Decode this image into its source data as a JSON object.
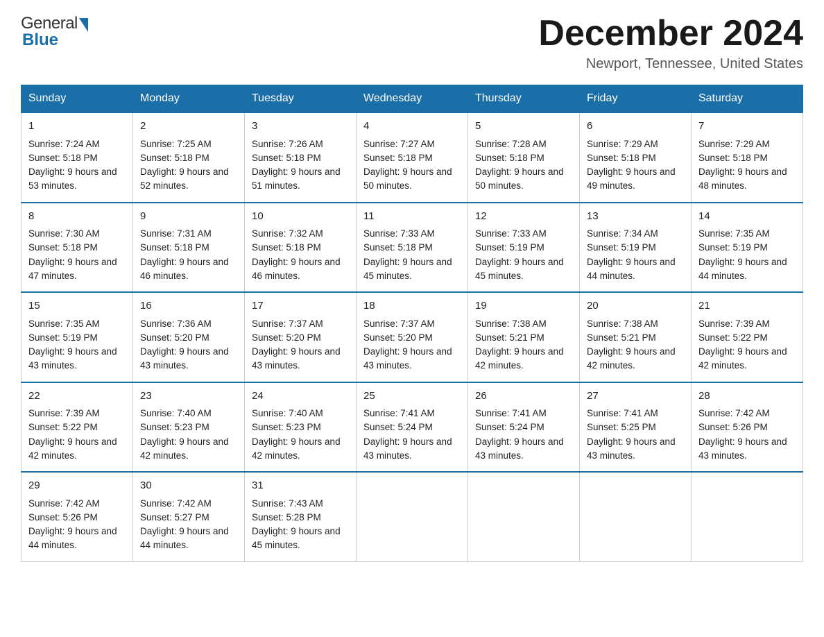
{
  "header": {
    "title": "December 2024",
    "subtitle": "Newport, Tennessee, United States",
    "logo_general": "General",
    "logo_blue": "Blue"
  },
  "days_of_week": [
    "Sunday",
    "Monday",
    "Tuesday",
    "Wednesday",
    "Thursday",
    "Friday",
    "Saturday"
  ],
  "weeks": [
    [
      {
        "day": "1",
        "sunrise": "7:24 AM",
        "sunset": "5:18 PM",
        "daylight": "9 hours and 53 minutes."
      },
      {
        "day": "2",
        "sunrise": "7:25 AM",
        "sunset": "5:18 PM",
        "daylight": "9 hours and 52 minutes."
      },
      {
        "day": "3",
        "sunrise": "7:26 AM",
        "sunset": "5:18 PM",
        "daylight": "9 hours and 51 minutes."
      },
      {
        "day": "4",
        "sunrise": "7:27 AM",
        "sunset": "5:18 PM",
        "daylight": "9 hours and 50 minutes."
      },
      {
        "day": "5",
        "sunrise": "7:28 AM",
        "sunset": "5:18 PM",
        "daylight": "9 hours and 50 minutes."
      },
      {
        "day": "6",
        "sunrise": "7:29 AM",
        "sunset": "5:18 PM",
        "daylight": "9 hours and 49 minutes."
      },
      {
        "day": "7",
        "sunrise": "7:29 AM",
        "sunset": "5:18 PM",
        "daylight": "9 hours and 48 minutes."
      }
    ],
    [
      {
        "day": "8",
        "sunrise": "7:30 AM",
        "sunset": "5:18 PM",
        "daylight": "9 hours and 47 minutes."
      },
      {
        "day": "9",
        "sunrise": "7:31 AM",
        "sunset": "5:18 PM",
        "daylight": "9 hours and 46 minutes."
      },
      {
        "day": "10",
        "sunrise": "7:32 AM",
        "sunset": "5:18 PM",
        "daylight": "9 hours and 46 minutes."
      },
      {
        "day": "11",
        "sunrise": "7:33 AM",
        "sunset": "5:18 PM",
        "daylight": "9 hours and 45 minutes."
      },
      {
        "day": "12",
        "sunrise": "7:33 AM",
        "sunset": "5:19 PM",
        "daylight": "9 hours and 45 minutes."
      },
      {
        "day": "13",
        "sunrise": "7:34 AM",
        "sunset": "5:19 PM",
        "daylight": "9 hours and 44 minutes."
      },
      {
        "day": "14",
        "sunrise": "7:35 AM",
        "sunset": "5:19 PM",
        "daylight": "9 hours and 44 minutes."
      }
    ],
    [
      {
        "day": "15",
        "sunrise": "7:35 AM",
        "sunset": "5:19 PM",
        "daylight": "9 hours and 43 minutes."
      },
      {
        "day": "16",
        "sunrise": "7:36 AM",
        "sunset": "5:20 PM",
        "daylight": "9 hours and 43 minutes."
      },
      {
        "day": "17",
        "sunrise": "7:37 AM",
        "sunset": "5:20 PM",
        "daylight": "9 hours and 43 minutes."
      },
      {
        "day": "18",
        "sunrise": "7:37 AM",
        "sunset": "5:20 PM",
        "daylight": "9 hours and 43 minutes."
      },
      {
        "day": "19",
        "sunrise": "7:38 AM",
        "sunset": "5:21 PM",
        "daylight": "9 hours and 42 minutes."
      },
      {
        "day": "20",
        "sunrise": "7:38 AM",
        "sunset": "5:21 PM",
        "daylight": "9 hours and 42 minutes."
      },
      {
        "day": "21",
        "sunrise": "7:39 AM",
        "sunset": "5:22 PM",
        "daylight": "9 hours and 42 minutes."
      }
    ],
    [
      {
        "day": "22",
        "sunrise": "7:39 AM",
        "sunset": "5:22 PM",
        "daylight": "9 hours and 42 minutes."
      },
      {
        "day": "23",
        "sunrise": "7:40 AM",
        "sunset": "5:23 PM",
        "daylight": "9 hours and 42 minutes."
      },
      {
        "day": "24",
        "sunrise": "7:40 AM",
        "sunset": "5:23 PM",
        "daylight": "9 hours and 42 minutes."
      },
      {
        "day": "25",
        "sunrise": "7:41 AM",
        "sunset": "5:24 PM",
        "daylight": "9 hours and 43 minutes."
      },
      {
        "day": "26",
        "sunrise": "7:41 AM",
        "sunset": "5:24 PM",
        "daylight": "9 hours and 43 minutes."
      },
      {
        "day": "27",
        "sunrise": "7:41 AM",
        "sunset": "5:25 PM",
        "daylight": "9 hours and 43 minutes."
      },
      {
        "day": "28",
        "sunrise": "7:42 AM",
        "sunset": "5:26 PM",
        "daylight": "9 hours and 43 minutes."
      }
    ],
    [
      {
        "day": "29",
        "sunrise": "7:42 AM",
        "sunset": "5:26 PM",
        "daylight": "9 hours and 44 minutes."
      },
      {
        "day": "30",
        "sunrise": "7:42 AM",
        "sunset": "5:27 PM",
        "daylight": "9 hours and 44 minutes."
      },
      {
        "day": "31",
        "sunrise": "7:43 AM",
        "sunset": "5:28 PM",
        "daylight": "9 hours and 45 minutes."
      },
      null,
      null,
      null,
      null
    ]
  ],
  "labels": {
    "sunrise_prefix": "Sunrise: ",
    "sunset_prefix": "Sunset: ",
    "daylight_prefix": "Daylight: "
  }
}
